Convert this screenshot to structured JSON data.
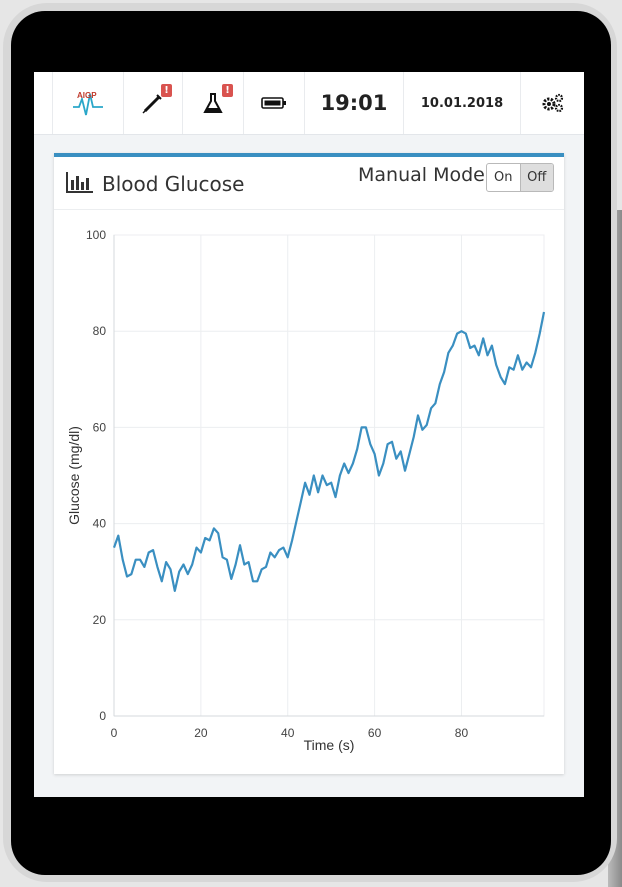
{
  "topbar": {
    "logo_text": "AIGP",
    "alert_mark": "!",
    "time": "19:01",
    "date": "10.01.2018"
  },
  "panel": {
    "title": "Blood Glucose",
    "manual_mode_label": "Manual Mode",
    "toggle_on": "On",
    "toggle_off": "Off",
    "toggle_selected": "Off"
  },
  "colors": {
    "accent": "#3a8fc1",
    "line": "#3a8fc1",
    "alert": "#d9534f"
  },
  "icons": [
    "aigp-logo-icon",
    "syringe-icon",
    "flask-icon",
    "battery-icon",
    "gears-icon",
    "bar-chart-icon"
  ],
  "chart_data": {
    "type": "line",
    "xlabel": "Time (s)",
    "ylabel": "Glucose (mg/dl)",
    "xlim": [
      0,
      99
    ],
    "ylim": [
      0,
      100
    ],
    "xticks": [
      0,
      20,
      40,
      60,
      80
    ],
    "yticks": [
      0,
      20,
      40,
      60,
      80,
      100
    ],
    "grid": true,
    "series": [
      {
        "x": [
          0,
          1,
          2,
          3,
          4,
          5,
          6,
          7,
          8,
          9,
          10,
          11,
          12,
          13,
          14,
          15,
          16,
          17,
          18,
          19,
          20,
          21,
          22,
          23,
          24,
          25,
          26,
          27,
          28,
          29,
          30,
          31,
          32,
          33,
          34,
          35,
          36,
          37,
          38,
          39,
          40,
          41,
          42,
          43,
          44,
          45,
          46,
          47,
          48,
          49,
          50,
          51,
          52,
          53,
          54,
          55,
          56,
          57,
          58,
          59,
          60,
          61,
          62,
          63,
          64,
          65,
          66,
          67,
          68,
          69,
          70,
          71,
          72,
          73,
          74,
          75,
          76,
          77,
          78,
          79,
          80,
          81,
          82,
          83,
          84,
          85,
          86,
          87,
          88,
          89,
          90,
          91,
          92,
          93,
          94,
          95,
          96,
          97,
          98,
          99
        ],
        "values": [
          35,
          37.5,
          32.5,
          29,
          29.5,
          32.5,
          32.5,
          31,
          34,
          34.5,
          31,
          28,
          32,
          30.5,
          26,
          30,
          31.5,
          29.5,
          31.5,
          35,
          34,
          37,
          36.5,
          39,
          38,
          33,
          32.5,
          28.5,
          31.5,
          35.5,
          31.5,
          32,
          28,
          28,
          30.5,
          31,
          34,
          33,
          34.5,
          35,
          33,
          36.5,
          40.5,
          44.5,
          48.5,
          46,
          50,
          46.5,
          50,
          48,
          48.5,
          45.5,
          50,
          52.5,
          50.5,
          52.5,
          55.5,
          60,
          60,
          56.5,
          54.5,
          50,
          52.5,
          56.5,
          57,
          53.5,
          55,
          51,
          54.5,
          58,
          62.5,
          59.5,
          60.5,
          64,
          65,
          69,
          71.5,
          75.5,
          77,
          79.5,
          80,
          79.5,
          76.5,
          77,
          75,
          78.5,
          75,
          77,
          73,
          70.5,
          69,
          72.5,
          72,
          75,
          72,
          73.5,
          72.5,
          75.5,
          79.5,
          84
        ]
      }
    ]
  }
}
